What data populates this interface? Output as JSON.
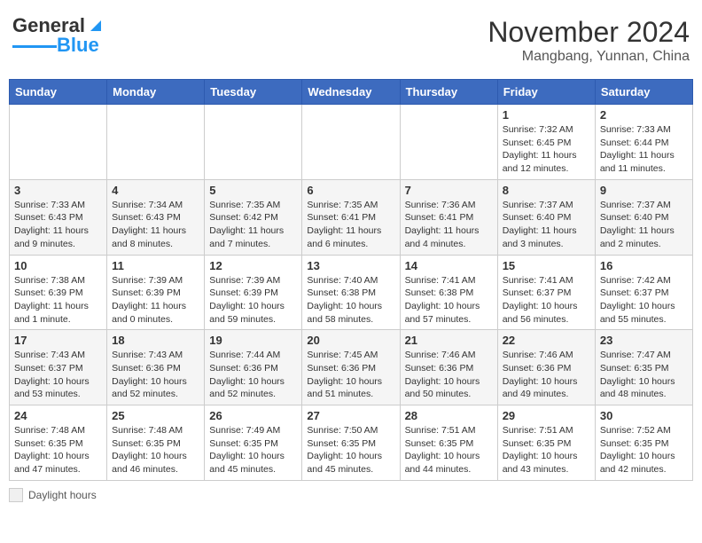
{
  "header": {
    "logo_general": "General",
    "logo_blue": "Blue",
    "month_title": "November 2024",
    "location": "Mangbang, Yunnan, China"
  },
  "weekdays": [
    "Sunday",
    "Monday",
    "Tuesday",
    "Wednesday",
    "Thursday",
    "Friday",
    "Saturday"
  ],
  "legend": {
    "label": "Daylight hours"
  },
  "weeks": [
    [
      {
        "day": "",
        "info": ""
      },
      {
        "day": "",
        "info": ""
      },
      {
        "day": "",
        "info": ""
      },
      {
        "day": "",
        "info": ""
      },
      {
        "day": "",
        "info": ""
      },
      {
        "day": "1",
        "info": "Sunrise: 7:32 AM\nSunset: 6:45 PM\nDaylight: 11 hours and 12 minutes."
      },
      {
        "day": "2",
        "info": "Sunrise: 7:33 AM\nSunset: 6:44 PM\nDaylight: 11 hours and 11 minutes."
      }
    ],
    [
      {
        "day": "3",
        "info": "Sunrise: 7:33 AM\nSunset: 6:43 PM\nDaylight: 11 hours and 9 minutes."
      },
      {
        "day": "4",
        "info": "Sunrise: 7:34 AM\nSunset: 6:43 PM\nDaylight: 11 hours and 8 minutes."
      },
      {
        "day": "5",
        "info": "Sunrise: 7:35 AM\nSunset: 6:42 PM\nDaylight: 11 hours and 7 minutes."
      },
      {
        "day": "6",
        "info": "Sunrise: 7:35 AM\nSunset: 6:41 PM\nDaylight: 11 hours and 6 minutes."
      },
      {
        "day": "7",
        "info": "Sunrise: 7:36 AM\nSunset: 6:41 PM\nDaylight: 11 hours and 4 minutes."
      },
      {
        "day": "8",
        "info": "Sunrise: 7:37 AM\nSunset: 6:40 PM\nDaylight: 11 hours and 3 minutes."
      },
      {
        "day": "9",
        "info": "Sunrise: 7:37 AM\nSunset: 6:40 PM\nDaylight: 11 hours and 2 minutes."
      }
    ],
    [
      {
        "day": "10",
        "info": "Sunrise: 7:38 AM\nSunset: 6:39 PM\nDaylight: 11 hours and 1 minute."
      },
      {
        "day": "11",
        "info": "Sunrise: 7:39 AM\nSunset: 6:39 PM\nDaylight: 11 hours and 0 minutes."
      },
      {
        "day": "12",
        "info": "Sunrise: 7:39 AM\nSunset: 6:39 PM\nDaylight: 10 hours and 59 minutes."
      },
      {
        "day": "13",
        "info": "Sunrise: 7:40 AM\nSunset: 6:38 PM\nDaylight: 10 hours and 58 minutes."
      },
      {
        "day": "14",
        "info": "Sunrise: 7:41 AM\nSunset: 6:38 PM\nDaylight: 10 hours and 57 minutes."
      },
      {
        "day": "15",
        "info": "Sunrise: 7:41 AM\nSunset: 6:37 PM\nDaylight: 10 hours and 56 minutes."
      },
      {
        "day": "16",
        "info": "Sunrise: 7:42 AM\nSunset: 6:37 PM\nDaylight: 10 hours and 55 minutes."
      }
    ],
    [
      {
        "day": "17",
        "info": "Sunrise: 7:43 AM\nSunset: 6:37 PM\nDaylight: 10 hours and 53 minutes."
      },
      {
        "day": "18",
        "info": "Sunrise: 7:43 AM\nSunset: 6:36 PM\nDaylight: 10 hours and 52 minutes."
      },
      {
        "day": "19",
        "info": "Sunrise: 7:44 AM\nSunset: 6:36 PM\nDaylight: 10 hours and 52 minutes."
      },
      {
        "day": "20",
        "info": "Sunrise: 7:45 AM\nSunset: 6:36 PM\nDaylight: 10 hours and 51 minutes."
      },
      {
        "day": "21",
        "info": "Sunrise: 7:46 AM\nSunset: 6:36 PM\nDaylight: 10 hours and 50 minutes."
      },
      {
        "day": "22",
        "info": "Sunrise: 7:46 AM\nSunset: 6:36 PM\nDaylight: 10 hours and 49 minutes."
      },
      {
        "day": "23",
        "info": "Sunrise: 7:47 AM\nSunset: 6:35 PM\nDaylight: 10 hours and 48 minutes."
      }
    ],
    [
      {
        "day": "24",
        "info": "Sunrise: 7:48 AM\nSunset: 6:35 PM\nDaylight: 10 hours and 47 minutes."
      },
      {
        "day": "25",
        "info": "Sunrise: 7:48 AM\nSunset: 6:35 PM\nDaylight: 10 hours and 46 minutes."
      },
      {
        "day": "26",
        "info": "Sunrise: 7:49 AM\nSunset: 6:35 PM\nDaylight: 10 hours and 45 minutes."
      },
      {
        "day": "27",
        "info": "Sunrise: 7:50 AM\nSunset: 6:35 PM\nDaylight: 10 hours and 45 minutes."
      },
      {
        "day": "28",
        "info": "Sunrise: 7:51 AM\nSunset: 6:35 PM\nDaylight: 10 hours and 44 minutes."
      },
      {
        "day": "29",
        "info": "Sunrise: 7:51 AM\nSunset: 6:35 PM\nDaylight: 10 hours and 43 minutes."
      },
      {
        "day": "30",
        "info": "Sunrise: 7:52 AM\nSunset: 6:35 PM\nDaylight: 10 hours and 42 minutes."
      }
    ]
  ]
}
